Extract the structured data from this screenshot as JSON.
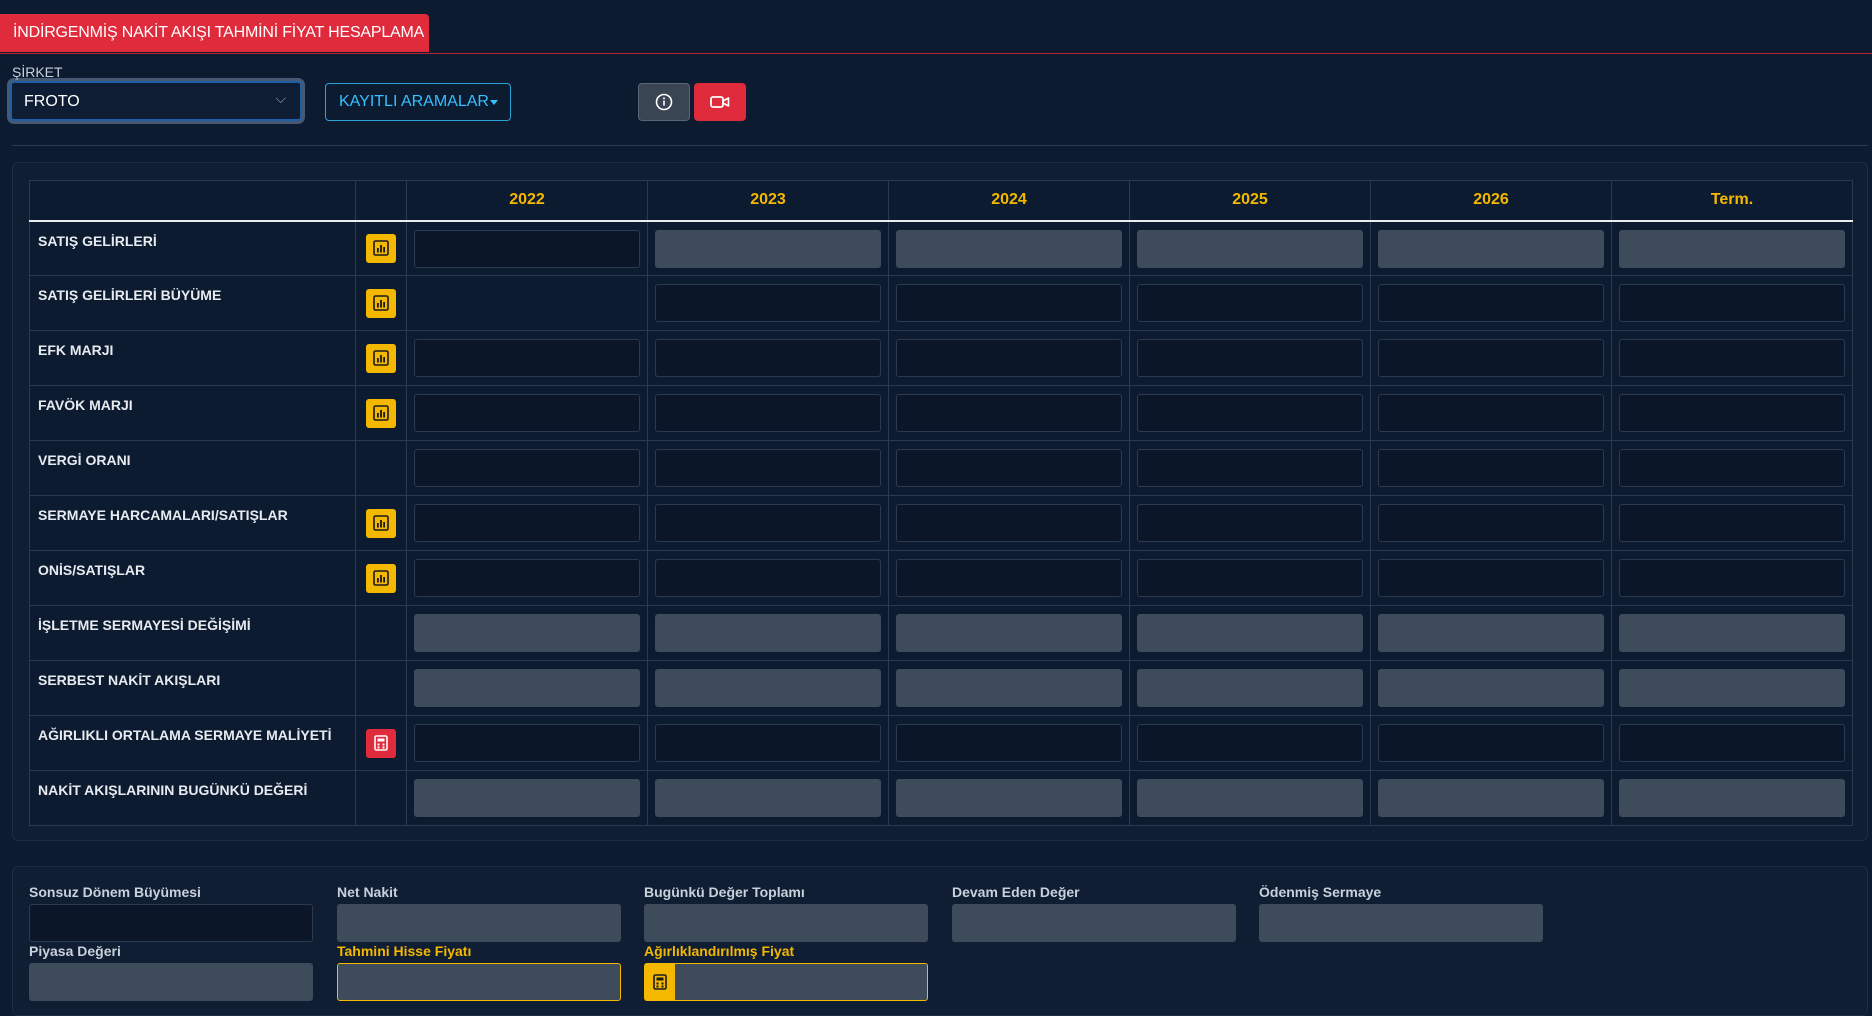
{
  "header": {
    "title": "İNDİRGENMİŞ NAKİT AKIŞI TAHMİNİ FİYAT HESAPLAMA"
  },
  "company": {
    "label": "ŞİRKET",
    "value": "FROTO"
  },
  "toolbar": {
    "saved_searches": "KAYITLI ARAMALAR",
    "info_icon": "info-icon",
    "video_icon": "video-camera-icon"
  },
  "colors": {
    "accent_red": "#e02b3c",
    "accent_gold": "#f5b800",
    "accent_blue": "#35c0ff",
    "background": "#0c1b30"
  },
  "table": {
    "columns": [
      "2022",
      "2023",
      "2024",
      "2025",
      "2026",
      "Term."
    ],
    "rows": [
      {
        "label": "SATIŞ GELİRLERİ",
        "icon": "chart",
        "cells": [
          "input",
          "readonly",
          "readonly",
          "readonly",
          "readonly",
          "readonly"
        ]
      },
      {
        "label": "SATIŞ GELİRLERİ BÜYÜME",
        "icon": "chart",
        "cells": [
          "none",
          "input",
          "input",
          "input",
          "input",
          "input"
        ]
      },
      {
        "label": "EFK MARJI",
        "icon": "chart",
        "cells": [
          "input",
          "input",
          "input",
          "input",
          "input",
          "input"
        ]
      },
      {
        "label": "FAVÖK MARJI",
        "icon": "chart",
        "cells": [
          "input",
          "input",
          "input",
          "input",
          "input",
          "input"
        ]
      },
      {
        "label": "VERGİ ORANI",
        "icon": "none",
        "cells": [
          "input",
          "input",
          "input",
          "input",
          "input",
          "input"
        ]
      },
      {
        "label": "SERMAYE HARCAMALARI/SATIŞLAR",
        "icon": "chart",
        "cells": [
          "input",
          "input",
          "input",
          "input",
          "input",
          "input"
        ]
      },
      {
        "label": "ONİS/SATIŞLAR",
        "icon": "chart",
        "cells": [
          "input",
          "input",
          "input",
          "input",
          "input",
          "input"
        ]
      },
      {
        "label": "İŞLETME SERMAYESİ DEĞİŞİMİ",
        "icon": "none",
        "cells": [
          "readonly",
          "readonly",
          "readonly",
          "readonly",
          "readonly",
          "readonly"
        ]
      },
      {
        "label": "SERBEST NAKİT AKIŞLARI",
        "icon": "none",
        "cells": [
          "readonly",
          "readonly",
          "readonly",
          "readonly",
          "readonly",
          "readonly"
        ]
      },
      {
        "label": "AĞIRLIKLI ORTALAMA SERMAYE MALİYETİ",
        "icon": "calculator",
        "cells": [
          "input",
          "input",
          "input",
          "input",
          "input",
          "input"
        ]
      },
      {
        "label": "NAKİT AKIŞLARININ BUGÜNKÜ DEĞERİ",
        "icon": "none",
        "cells": [
          "readonly",
          "readonly",
          "readonly",
          "readonly",
          "readonly",
          "readonly"
        ]
      }
    ]
  },
  "summary": {
    "terminal_growth": "Sonsuz Dönem Büyümesi",
    "net_cash": "Net Nakit",
    "pv_total": "Bugünkü Değer Toplamı",
    "continuing_value": "Devam Eden Değer",
    "paid_capital": "Ödenmiş Sermaye",
    "market_value": "Piyasa Değeri",
    "est_share_price": "Tahmini Hisse Fiyatı",
    "weighted_price": "Ağırlıklandırılmış Fiyat"
  }
}
